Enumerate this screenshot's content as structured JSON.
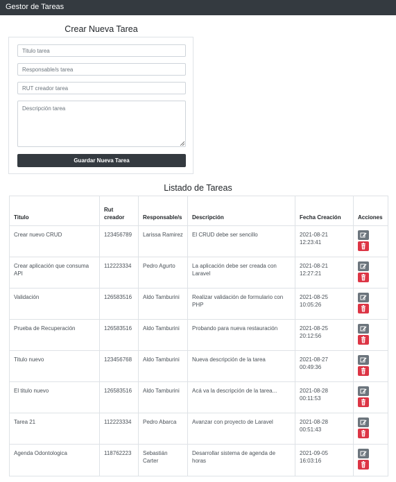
{
  "navbar": {
    "brand": "Gestor de Tareas"
  },
  "create": {
    "title": "Crear Nueva Tarea",
    "fields": {
      "title_placeholder": "Titulo tarea",
      "responsible_placeholder": "Responsable/s tarea",
      "rut_placeholder": "RUT creador tarea",
      "description_placeholder": "Descripción tarea"
    },
    "save_label": "Guardar Nueva Tarea"
  },
  "list": {
    "title": "Listado de Tareas",
    "headers": {
      "titulo": "Titulo",
      "rut_line1": "Rut",
      "rut_line2": "creador",
      "responsable": "Responsable/s",
      "descripcion": "Descripción",
      "fecha": "Fecha Creación",
      "acciones": "Acciones"
    },
    "rows": [
      {
        "titulo": "Crear nuevo CRUD",
        "rut": "123456789",
        "responsable": "Larissa Ramirez",
        "descripcion": "El CRUD debe ser sencillo",
        "fecha": "2021-08-21 12:23:41"
      },
      {
        "titulo": "Crear aplicación que consuma API",
        "rut": "112223334",
        "responsable": "Pedro Agurto",
        "descripcion": "La aplicación debe ser creada con Laravel",
        "fecha": "2021-08-21 12:27:21"
      },
      {
        "titulo": "Validación",
        "rut": "126583516",
        "responsable": "Aldo Tamburini",
        "descripcion": "Realizar validación de formulario con PHP",
        "fecha": "2021-08-25 10:05:26"
      },
      {
        "titulo": "Prueba de Recuperación",
        "rut": "126583516",
        "responsable": "Aldo Tamburini",
        "descripcion": "Probando para nueva restauración",
        "fecha": "2021-08-25 20:12:56"
      },
      {
        "titulo": "Titulo nuevo",
        "rut": "123456768",
        "responsable": "Aldo Tamburini",
        "descripcion": "Nueva descripción de la tarea",
        "fecha": "2021-08-27 00:49:36"
      },
      {
        "titulo": "El titulo nuevo",
        "rut": "126583516",
        "responsable": "Aldo Tamburini",
        "descripcion": "Acá va la descripción de la tarea...",
        "fecha": "2021-08-28 00:11:53"
      },
      {
        "titulo": "Tarea 21",
        "rut": "112223334",
        "responsable": "Pedro Abarca",
        "descripcion": "Avanzar con proyecto de Laravel",
        "fecha": "2021-08-28 00:51:43"
      },
      {
        "titulo": "Agenda Odontologica",
        "rut": "118762223",
        "responsable": "Sebastián Carter",
        "descripcion": "Desarrollar sistema de agenda de horas",
        "fecha": "2021-09-05 16:03:16"
      }
    ],
    "actions": {
      "edit_icon": "edit-icon",
      "delete_icon": "trash-icon"
    }
  },
  "colors": {
    "dark": "#343a40",
    "secondary": "#6c757d",
    "danger": "#dc3545"
  }
}
